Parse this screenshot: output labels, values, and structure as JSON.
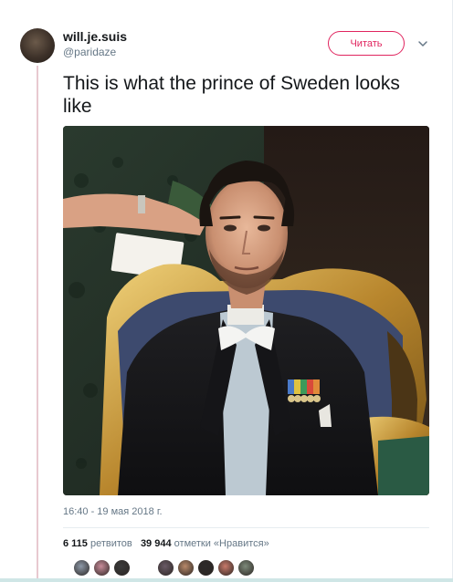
{
  "user": {
    "display_name": "will.je.suis",
    "handle": "@paridaze",
    "follow_label": "Читать"
  },
  "tweet": {
    "text": "This is what the prince of Sweden looks like",
    "timestamp": "16:40 - 19 мая 2018 г."
  },
  "stats": {
    "retweets_count": "6 115",
    "retweets_label": "ретвитов",
    "likes_count": "39 944",
    "likes_label": "отметки «Нравится»"
  },
  "likers": {
    "avatars": [
      {
        "name": "liker-avatar-1",
        "color": "#8d99a8"
      },
      {
        "name": "liker-avatar-2",
        "color": "#c98c9a"
      },
      {
        "name": "liker-avatar-3",
        "color": "#3b3b3b"
      },
      {
        "name": "liker-avatar-4",
        "color": "#6a5a66"
      },
      {
        "name": "liker-avatar-5",
        "color": "#b98a6a"
      },
      {
        "name": "liker-avatar-6",
        "color": "#2d2a2a"
      },
      {
        "name": "liker-avatar-7",
        "color": "#c97a6a"
      },
      {
        "name": "liker-avatar-8",
        "color": "#7d8a7a"
      },
      {
        "name": "liker-avatar-9",
        "color": "#a07060"
      }
    ]
  },
  "icons": {
    "chevron": "chevron-down-icon",
    "avatar": "profile-avatar"
  }
}
